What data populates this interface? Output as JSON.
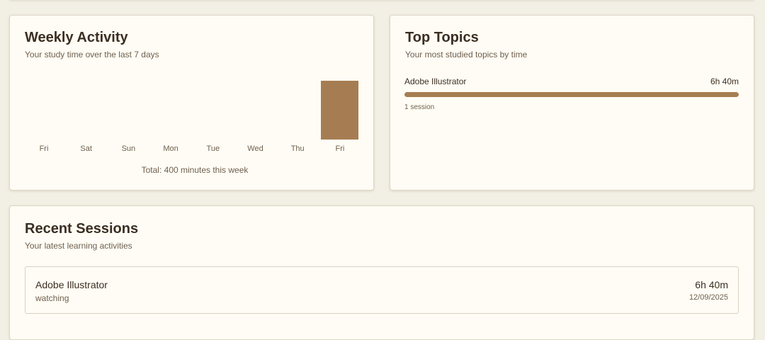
{
  "weekly_activity": {
    "title": "Weekly Activity",
    "subtitle": "Your study time over the last 7 days",
    "total_text": "Total: 400 minutes this week"
  },
  "chart_data": {
    "type": "bar",
    "categories": [
      "Fri",
      "Sat",
      "Sun",
      "Mon",
      "Tue",
      "Wed",
      "Thu",
      "Fri"
    ],
    "values": [
      0,
      0,
      0,
      0,
      0,
      0,
      0,
      400
    ],
    "title": "",
    "xlabel": "",
    "ylabel": "",
    "ylim": [
      0,
      400
    ],
    "grid": false,
    "bar_color": "#a67d52"
  },
  "top_topics": {
    "title": "Top Topics",
    "subtitle": "Your most studied topics by time",
    "items": [
      {
        "name": "Adobe Illustrator",
        "time": "6h 40m",
        "sessions": "1 session",
        "share": 1.0
      }
    ],
    "bar_color": "#a67d52"
  },
  "recent_sessions": {
    "title": "Recent Sessions",
    "subtitle": "Your latest learning activities",
    "items": [
      {
        "name": "Adobe Illustrator",
        "type": "watching",
        "duration": "6h 40m",
        "date": "12/09/2025"
      }
    ]
  }
}
